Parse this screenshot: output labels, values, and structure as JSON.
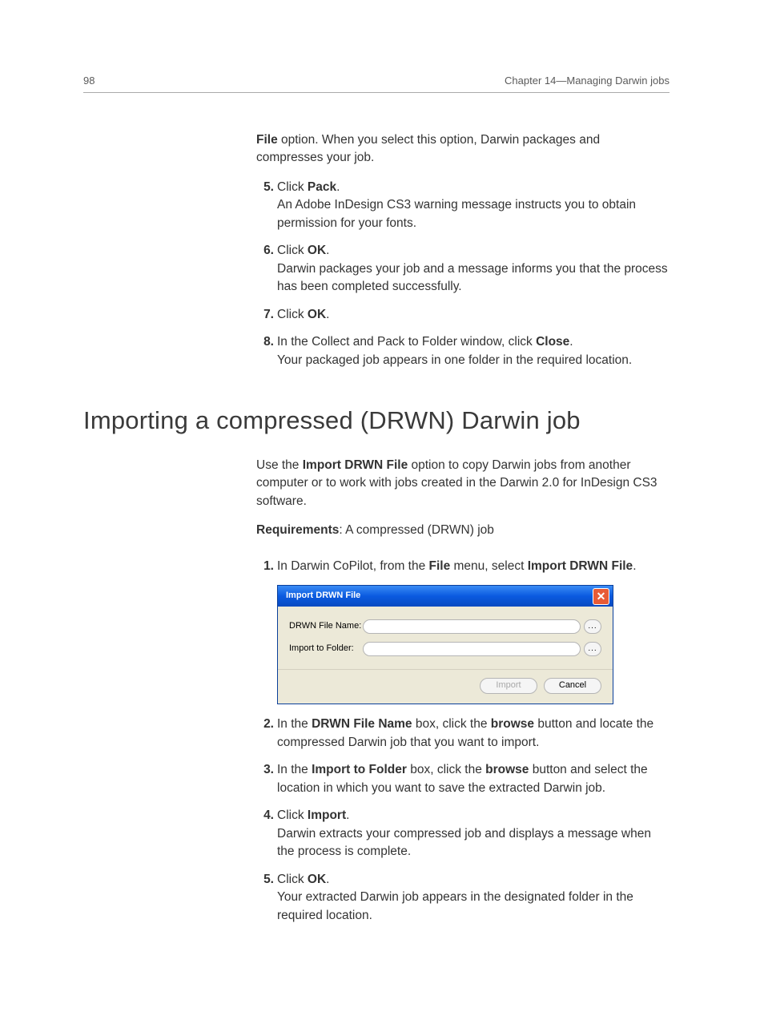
{
  "header": {
    "page_number": "98",
    "chapter": "Chapter 14—Managing Darwin jobs"
  },
  "continuation": {
    "bold_part": "File",
    "rest": " option. When you select this option, Darwin packages and compresses your job."
  },
  "steps_top": [
    {
      "num": "5.",
      "lead": "Click ",
      "bold": "Pack",
      "after": ".",
      "detail": "An Adobe InDesign CS3 warning message instructs you to obtain permission for your fonts."
    },
    {
      "num": "6.",
      "lead": "Click ",
      "bold": "OK",
      "after": ".",
      "detail": "Darwin packages your job and a message informs you that the process has been completed successfully."
    },
    {
      "num": "7.",
      "lead": "Click ",
      "bold": "OK",
      "after": ".",
      "detail": ""
    },
    {
      "num": "8.",
      "lead": "In the Collect and Pack to Folder window, click ",
      "bold": "Close",
      "after": ".",
      "detail": "Your packaged job appears in one folder in the required location."
    }
  ],
  "section_title": "Importing a compressed (DRWN) Darwin job",
  "intro": {
    "pre": "Use the ",
    "bold": "Import DRWN File",
    "post": " option to copy Darwin jobs from another computer or to work with jobs created in the Darwin 2.0 for InDesign CS3 software."
  },
  "requirements": {
    "label": "Requirements",
    "text": ": A compressed (DRWN) job"
  },
  "steps_import": [
    {
      "num": "1.",
      "pre": "In Darwin CoPilot, from the ",
      "b1": "File",
      "mid": " menu, select ",
      "b2": "Import DRWN File",
      "after": "."
    },
    {
      "num": "2.",
      "pre": "In the ",
      "b1": "DRWN File Name",
      "mid": " box, click the ",
      "b2": "browse",
      "after": " button and locate the compressed Darwin job that you want to import."
    },
    {
      "num": "3.",
      "pre": "In the ",
      "b1": "Import to Folder",
      "mid": " box, click the ",
      "b2": "browse",
      "after": " button and select the location in which you want to save the extracted Darwin job."
    },
    {
      "num": "4.",
      "pre": "Click ",
      "b1": "Import",
      "mid": "",
      "b2": "",
      "after": ".",
      "detail": "Darwin extracts your compressed job and displays a message when the process is complete."
    },
    {
      "num": "5.",
      "pre": "Click ",
      "b1": "OK",
      "mid": "",
      "b2": "",
      "after": ".",
      "detail": "Your extracted Darwin job appears in the designated folder in the required location."
    }
  ],
  "dialog": {
    "title": "Import DRWN File",
    "close_glyph": "✕",
    "field1_label": "DRWN File Name:",
    "field2_label": "Import to Folder:",
    "browse_glyph": "...",
    "btn_import": "Import",
    "btn_cancel": "Cancel"
  }
}
